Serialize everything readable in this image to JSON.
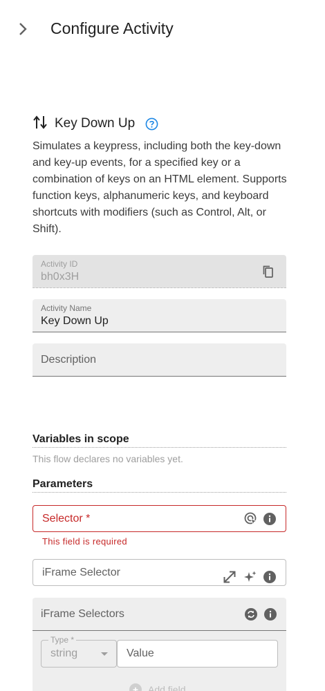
{
  "header": {
    "title": "Configure Activity",
    "collapse_icon": "chevron-right-icon"
  },
  "activity": {
    "title": "Key Down Up",
    "icon": "swap-vertical-icon",
    "help_icon": "help-circle-icon",
    "description": "Simulates a keypress, including both the key-down and key-up events, for a specified key or a combination of keys on an HTML element. Supports function keys, alphanumeric keys, and keyboard shortcuts with modifiers (such as Control, Alt, or Shift)."
  },
  "fields": {
    "activity_id": {
      "label": "Activity ID",
      "value": "bh0x3H",
      "icon": "copy-icon"
    },
    "activity_name": {
      "label": "Activity Name",
      "value": "Key Down Up"
    },
    "description": {
      "placeholder": "Description"
    }
  },
  "variables": {
    "title": "Variables in scope",
    "note": "This flow declares no variables yet."
  },
  "parameters": {
    "title": "Parameters",
    "selector": {
      "label": "Selector *",
      "error": "This field is required"
    },
    "iframe_selector": {
      "label": "iFrame Selector"
    },
    "iframe_selectors": {
      "title": "iFrame Selectors",
      "type_label": "Type *",
      "type_value": "string",
      "value_placeholder": "Value",
      "add_label": "Add field"
    }
  },
  "colors": {
    "error": "#c62828",
    "accent": "#1e88e5",
    "field_bg": "#eeeeee"
  }
}
